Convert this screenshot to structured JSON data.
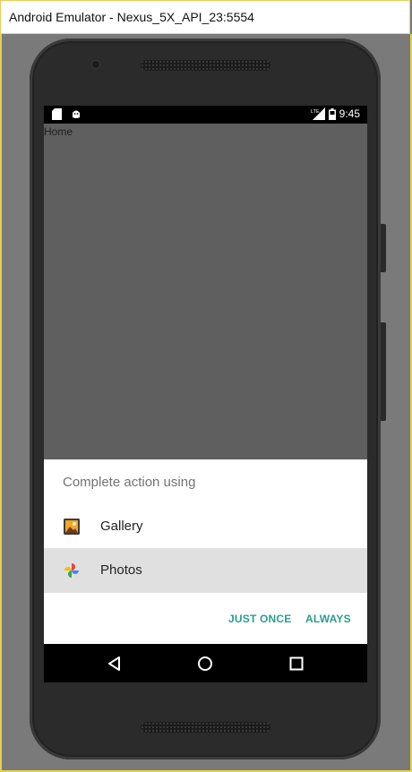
{
  "window": {
    "title": "Android Emulator - Nexus_5X_API_23:5554"
  },
  "statusbar": {
    "left_icons": [
      "sd-card-icon",
      "android-debug-icon"
    ],
    "right_icons": [
      "lte-signal-icon",
      "battery-icon"
    ],
    "time": "9:45",
    "lte_label": "LTE"
  },
  "app": {
    "home_label": "Home"
  },
  "chooser": {
    "title": "Complete action using",
    "options": [
      {
        "label": "Gallery",
        "icon": "gallery-app-icon"
      },
      {
        "label": "Photos",
        "icon": "photos-app-icon",
        "selected": true
      }
    ],
    "just_once": "JUST ONCE",
    "always": "ALWAYS",
    "accent_color": "#2a9d8f"
  },
  "navbar": {
    "icons": [
      "back-icon",
      "home-icon",
      "recents-icon"
    ]
  }
}
